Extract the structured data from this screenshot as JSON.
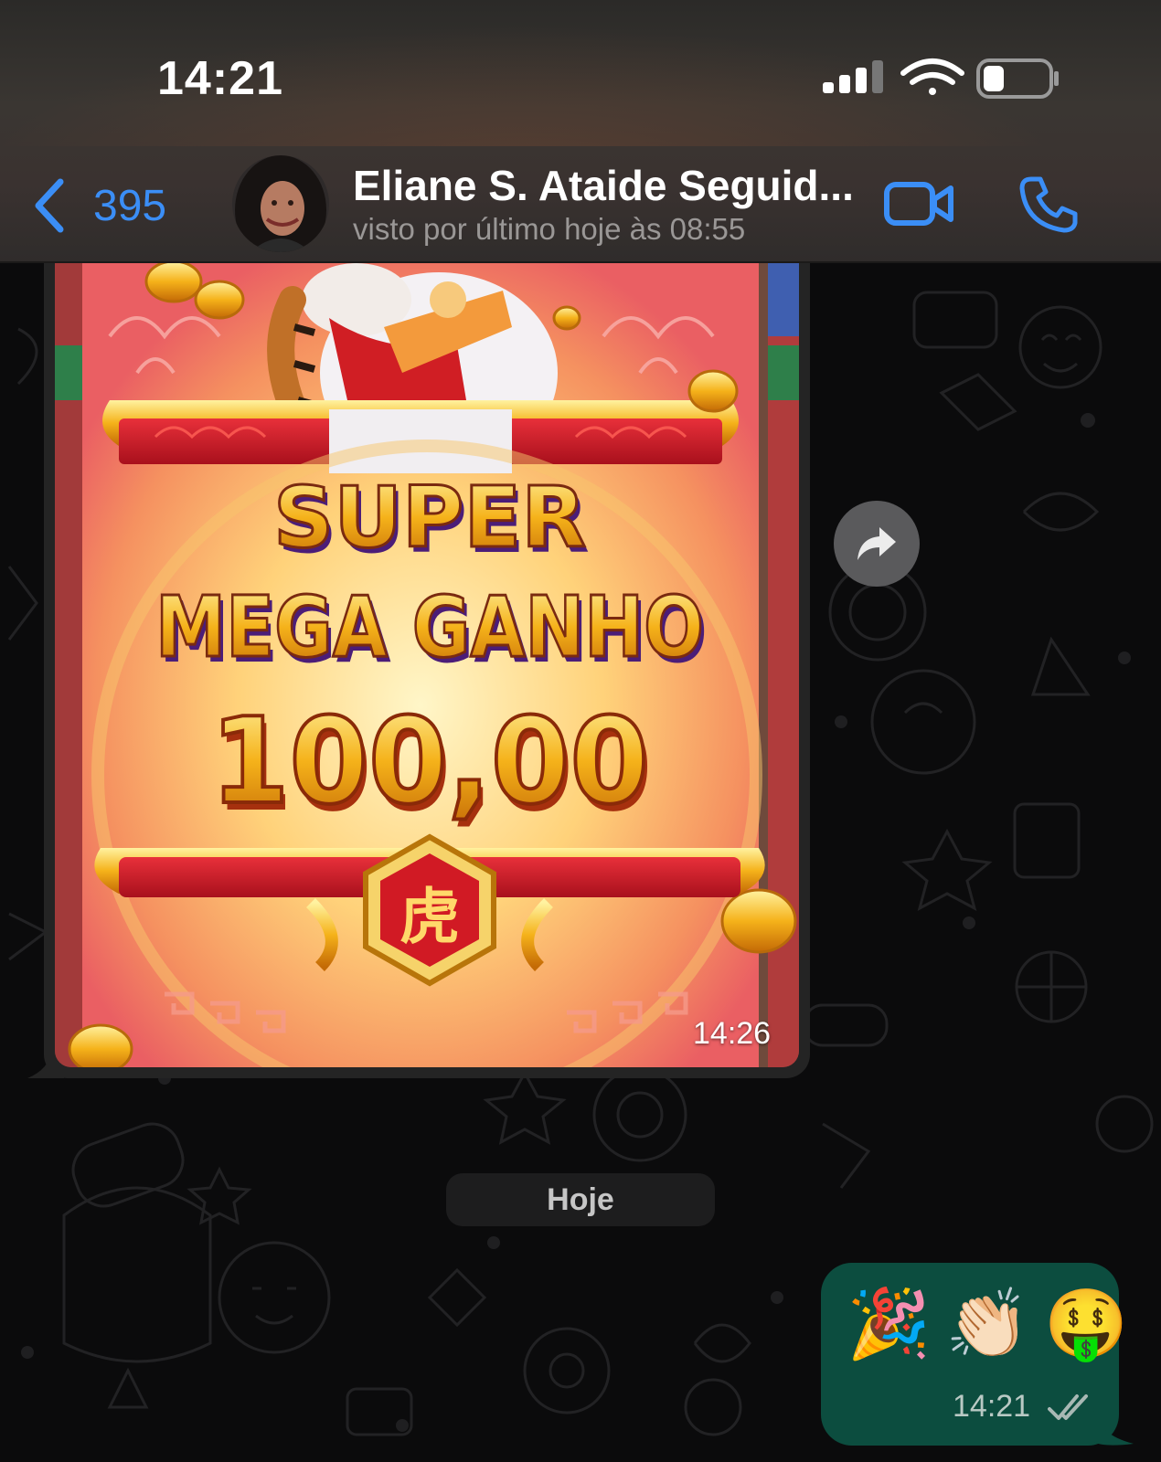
{
  "status_bar": {
    "time": "14:21"
  },
  "header": {
    "back_count": "395",
    "contact_name": "Eliane S. Ataide Seguid...",
    "last_seen": "visto por último hoje às 08:55"
  },
  "messages": {
    "image_message": {
      "game_text_line1": "SUPER",
      "game_text_line2": "MEGA GANHO",
      "game_amount": "100,00",
      "game_emblem": "虎",
      "time": "14:26"
    },
    "date_separator": "Hoje",
    "outgoing": {
      "emojis": [
        "🎉",
        "👏🏻",
        "🤑"
      ],
      "time": "14:21",
      "status_icon": "double-check-icon"
    }
  },
  "colors": {
    "accent_blue": "#3b8ef6",
    "outgoing_bubble": "#0c4d3f",
    "background": "#0b0b0c"
  }
}
